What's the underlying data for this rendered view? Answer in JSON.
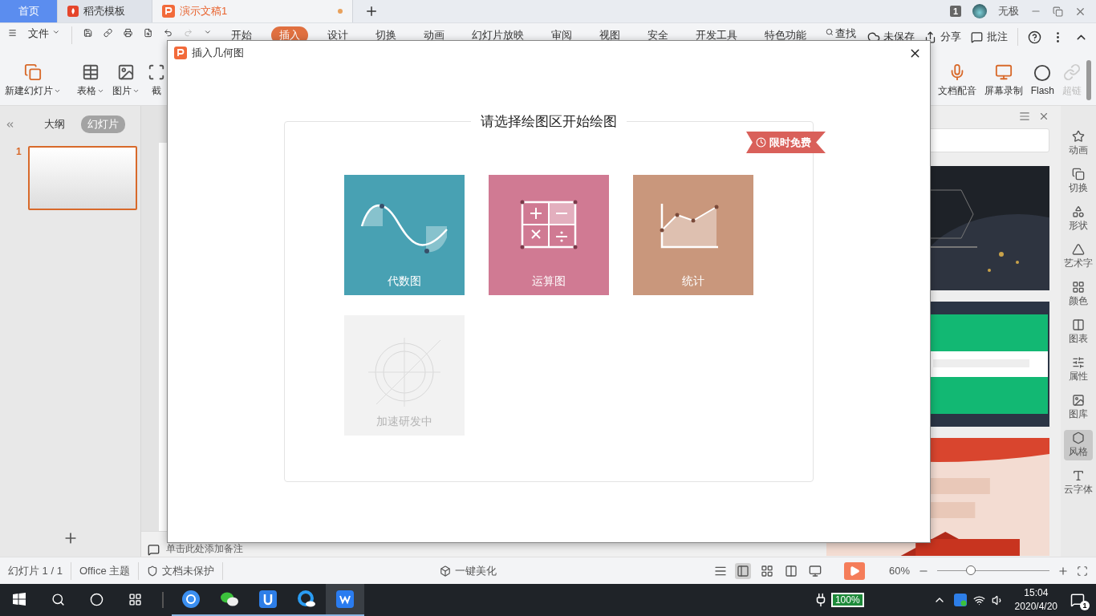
{
  "title_bar": {
    "tabs": [
      {
        "label": "首页",
        "kind": "home",
        "selected": false
      },
      {
        "label": "稻壳模板",
        "kind": "docer",
        "selected": false
      },
      {
        "label": "演示文稿1",
        "kind": "doc",
        "selected": true,
        "modified": true
      }
    ],
    "window_count": "1",
    "user": "无极"
  },
  "menu_bar": {
    "file": "文件",
    "tabs": [
      {
        "label": "开始",
        "selected": false
      },
      {
        "label": "插入",
        "selected": true
      },
      {
        "label": "设计",
        "selected": false
      },
      {
        "label": "切换",
        "selected": false
      },
      {
        "label": "动画",
        "selected": false
      },
      {
        "label": "幻灯片放映",
        "selected": false
      },
      {
        "label": "审阅",
        "selected": false
      },
      {
        "label": "视图",
        "selected": false
      },
      {
        "label": "安全",
        "selected": false
      },
      {
        "label": "开发工具",
        "selected": false
      },
      {
        "label": "特色功能",
        "selected": false
      }
    ],
    "search": "查找",
    "save_status": "未保存",
    "actions": [
      "分享",
      "批注"
    ]
  },
  "ribbon": {
    "left": [
      {
        "label": "新建幻灯片",
        "dropdown": true
      },
      {
        "label": "表格",
        "dropdown": true
      },
      {
        "label": "图片",
        "dropdown": true
      },
      {
        "label": "截",
        "dropdown": false
      }
    ],
    "right": [
      {
        "label": "文档配音",
        "disabled": false
      },
      {
        "label": "屏幕录制",
        "disabled": false
      },
      {
        "label": "Flash",
        "disabled": false
      },
      {
        "label": "超链",
        "disabled": true
      }
    ]
  },
  "left_panel": {
    "tabs": [
      {
        "label": "大纲",
        "selected": false
      },
      {
        "label": "幻灯片",
        "selected": true
      }
    ],
    "slides": [
      {
        "number": "1",
        "selected": true
      }
    ]
  },
  "notes": {
    "placeholder": "单击此处添加备注"
  },
  "sidebar": {
    "items": [
      {
        "label": "动画",
        "selected": false
      },
      {
        "label": "切换",
        "selected": false
      },
      {
        "label": "形状",
        "selected": false
      },
      {
        "label": "艺术字",
        "selected": false
      },
      {
        "label": "颜色",
        "selected": false
      },
      {
        "label": "图表",
        "selected": false
      },
      {
        "label": "属性",
        "selected": false
      },
      {
        "label": "图库",
        "selected": false
      },
      {
        "label": "风格",
        "selected": true
      },
      {
        "label": "云字体",
        "selected": false
      }
    ]
  },
  "status_bar": {
    "slide": "幻灯片 1 / 1",
    "theme": "Office 主题",
    "protection": "文档未保护",
    "beautify": "一键美化",
    "views": [
      {
        "selected": true
      },
      {
        "selected": false
      },
      {
        "selected": false
      },
      {
        "selected": false
      }
    ],
    "zoom": "60%",
    "zoom_slider": {
      "level": 0.3
    }
  },
  "taskbar": {
    "apps": [
      {
        "selected": false
      },
      {
        "selected": false
      },
      {
        "selected": false
      },
      {
        "selected": false
      },
      {
        "selected": true
      }
    ],
    "battery": "100%",
    "time": "15:04",
    "date": "2020/4/20",
    "notifications": "1"
  },
  "dialog": {
    "title": "插入几何图",
    "heading": "请选择绘图区开始绘图",
    "ribbon": "限时免费",
    "cards": [
      {
        "label": "代数图",
        "kind": "algebra",
        "color": "#48a1b3",
        "disabled": false
      },
      {
        "label": "运算图",
        "kind": "operation",
        "color": "#d07a93",
        "disabled": false
      },
      {
        "label": "统计",
        "kind": "statistics",
        "color": "#c9977c",
        "disabled": false
      },
      {
        "label": "加速研发中",
        "kind": "placeholder",
        "disabled": true
      }
    ]
  }
}
